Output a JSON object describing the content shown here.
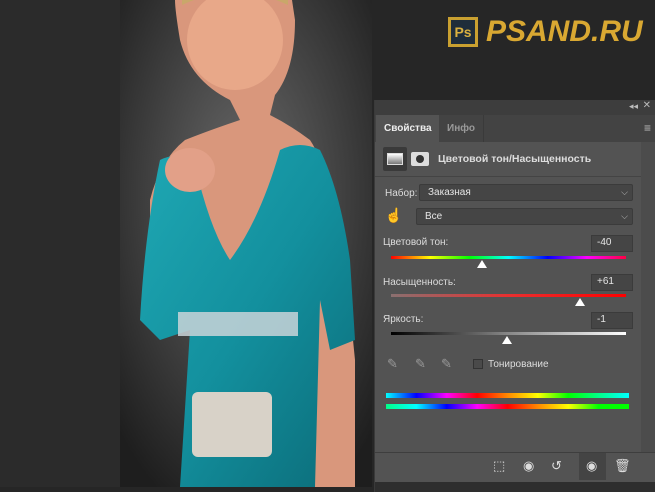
{
  "logo": {
    "badge": "Ps",
    "text": "PSAND.RU"
  },
  "panel": {
    "tabs": [
      {
        "label": "Свойства",
        "active": true
      },
      {
        "label": "Инфо",
        "active": false
      }
    ],
    "title": "Цветовой тон/Насыщенность",
    "preset_label": "Набор:",
    "preset_value": "Заказная",
    "channel_value": "Все",
    "hue": {
      "label": "Цветовой тон:",
      "value": "-40",
      "position": -40,
      "range": [
        -180,
        180
      ]
    },
    "saturation": {
      "label": "Насыщенность:",
      "value": "+61",
      "position": 61,
      "range": [
        -100,
        100
      ]
    },
    "lightness": {
      "label": "Яркость:",
      "value": "-1",
      "position": -1,
      "range": [
        -100,
        100
      ]
    },
    "colorize": {
      "label": "Тонирование",
      "checked": false
    }
  }
}
